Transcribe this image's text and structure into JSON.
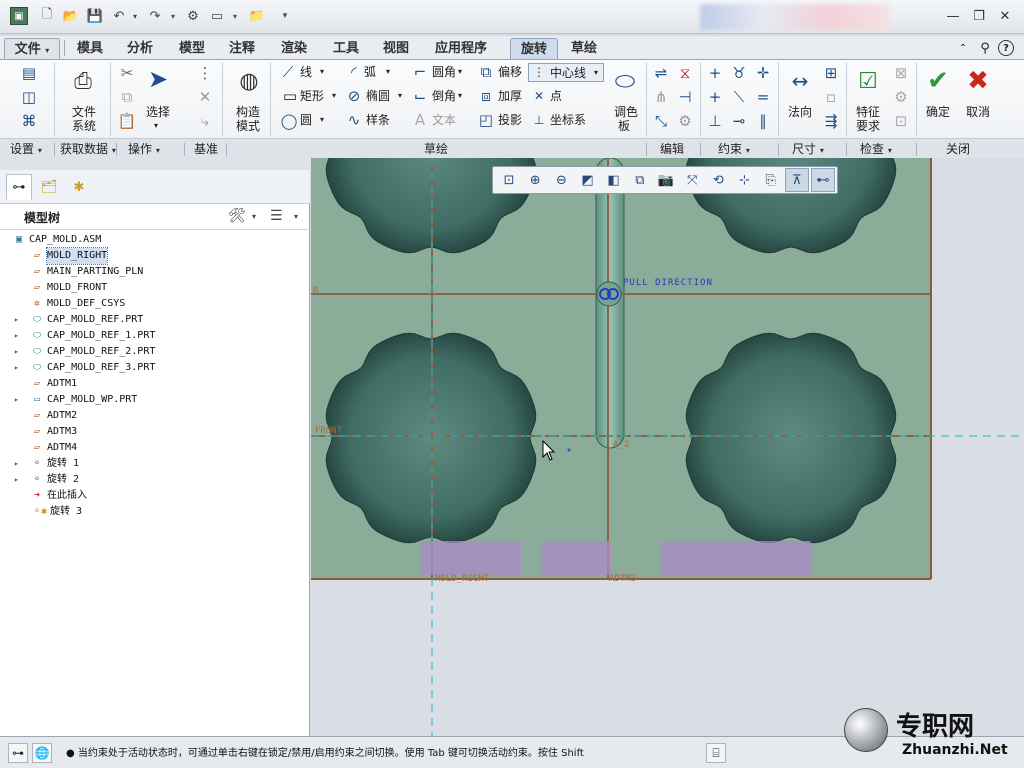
{
  "titlebar": {
    "quick_access_icons": [
      "app-logo-icon",
      "new-icon",
      "open-icon",
      "save-icon",
      "undo-icon",
      "redo-icon",
      "regenerate-icon",
      "window-icon",
      "folder-icon",
      "customize-icon"
    ],
    "window_controls": {
      "minimize": "—",
      "restore": "❐",
      "close": "✕"
    }
  },
  "tabs": {
    "file": "文件",
    "items": [
      "模具",
      "分析",
      "模型",
      "注释",
      "渲染",
      "工具",
      "视图",
      "应用程序",
      "旋转",
      "草绘"
    ],
    "active": "旋转",
    "file_caret": "▾"
  },
  "ribbon": {
    "file_system": "文件\n系统",
    "file_system_l1": "文件",
    "file_system_l2": "系统",
    "select": "选择",
    "construct_l1": "构造",
    "construct_l2": "模式",
    "line": "线",
    "arc": "弧",
    "rectangle": "矩形",
    "ellipse": "椭圆",
    "circle": "圆",
    "spline": "样条",
    "fillet": "圆角",
    "chamfer": "倒角",
    "text": "文本",
    "offset": "偏移",
    "thicken": "加厚",
    "project": "投影",
    "centerline": "中心线",
    "point": "点",
    "coordsys": "坐标系",
    "palette_l1": "调色",
    "palette_l2": "板",
    "normal": "法向",
    "feature_req_l1": "特征",
    "feature_req_l2": "要求",
    "ok": "确定",
    "cancel": "取消"
  },
  "groups": {
    "setup": "设置",
    "get_data": "获取数据",
    "operations": "操作",
    "datum": "基准",
    "sketch": "草绘",
    "edit": "编辑",
    "constrain": "约束",
    "dimension": "尺寸",
    "inspect": "检查",
    "close": "关闭"
  },
  "model_tree": {
    "title": "模型树",
    "items": [
      {
        "label": "CAP_MOLD.ASM",
        "type": "asm",
        "level": 0,
        "expand": false
      },
      {
        "label": "MOLD_RIGHT",
        "type": "plane",
        "level": 1,
        "expand": false,
        "selected": true
      },
      {
        "label": "MAIN_PARTING_PLN",
        "type": "plane",
        "level": 1,
        "expand": false
      },
      {
        "label": "MOLD_FRONT",
        "type": "plane",
        "level": 1,
        "expand": false
      },
      {
        "label": "MOLD_DEF_CSYS",
        "type": "csys",
        "level": 1,
        "expand": false
      },
      {
        "label": "CAP_MOLD_REF.PRT",
        "type": "part",
        "level": 1,
        "expand": true
      },
      {
        "label": "CAP_MOLD_REF_1.PRT",
        "type": "part",
        "level": 1,
        "expand": true
      },
      {
        "label": "CAP_MOLD_REF_2.PRT",
        "type": "part",
        "level": 1,
        "expand": true
      },
      {
        "label": "CAP_MOLD_REF_3.PRT",
        "type": "part",
        "level": 1,
        "expand": true
      },
      {
        "label": "ADTM1",
        "type": "plane",
        "level": 1,
        "expand": false
      },
      {
        "label": "CAP_MOLD_WP.PRT",
        "type": "workpiece",
        "level": 1,
        "expand": true
      },
      {
        "label": "ADTM2",
        "type": "plane",
        "level": 1,
        "expand": false
      },
      {
        "label": "ADTM3",
        "type": "plane",
        "level": 1,
        "expand": false
      },
      {
        "label": "ADTM4",
        "type": "plane",
        "level": 1,
        "expand": false
      },
      {
        "label": "旋转 1",
        "type": "revolve",
        "level": 1,
        "expand": true
      },
      {
        "label": "旋转 2",
        "type": "revolve",
        "level": 1,
        "expand": true
      },
      {
        "label": "在此插入",
        "type": "insert",
        "level": 1,
        "expand": false
      },
      {
        "label": "旋转 3",
        "type": "revolve-active",
        "level": 1,
        "expand": false
      }
    ]
  },
  "graphics": {
    "pull_direction": "PULL DIRECTION",
    "datum_labels": {
      "front": "FRONT",
      "axis": "A_2",
      "mold_right": "MOLD_RIGHT",
      "adtm3": "ADTM3",
      "left_mark": "R"
    }
  },
  "statusbar": {
    "message": "● 当约束处于活动状态时，可通过单击右键在锁定/禁用/启用约束之间切换。使用 Tab 键可切换活动约束。按住 Shift"
  },
  "watermark": {
    "cn": "专职网",
    "en": "Zhuanzhi.Net"
  },
  "colors": {
    "canvas_bg": "#8aac98",
    "plate_border": "#8a5a40",
    "datum_line": "#8a6448",
    "axis_cyan": "#18b8c8",
    "pull_blue": "#1f3fbf",
    "ok_green": "#2e9a3a",
    "cancel_red": "#c8281e"
  }
}
